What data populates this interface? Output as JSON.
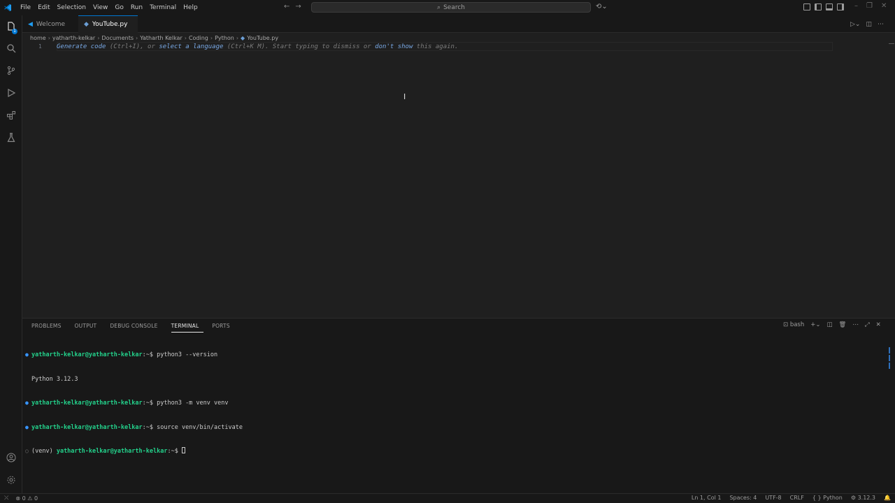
{
  "menu": [
    "File",
    "Edit",
    "Selection",
    "View",
    "Go",
    "Run",
    "Terminal",
    "Help"
  ],
  "search": {
    "placeholder": "Search"
  },
  "tabs": [
    {
      "label": "Welcome"
    },
    {
      "label": "YouTube.py"
    }
  ],
  "breadcrumb": [
    "home",
    "yatharth-kelkar",
    "Documents",
    "Yatharth Kelkar",
    "Coding",
    "Python",
    "YouTube.py"
  ],
  "editor": {
    "line_number": "1",
    "hint": {
      "generate": "Generate code",
      "shortcut1": " (Ctrl+I), or ",
      "select_lang": "select a language",
      "shortcut2": " (Ctrl+K M). Start typing to dismiss or ",
      "dont_show": "don't show",
      "tail": " this again."
    }
  },
  "activity_badge": "1",
  "panel": {
    "tabs": [
      "PROBLEMS",
      "OUTPUT",
      "DEBUG CONSOLE",
      "TERMINAL",
      "PORTS"
    ],
    "terminal_name": "bash",
    "lines": [
      {
        "prompt": "yatharth-kelkar@yatharth-kelkar",
        "suffix": ":~$ ",
        "cmd": "python3 --version",
        "dot": true
      },
      {
        "prompt": "",
        "suffix": "",
        "cmd": "Python 3.12.3",
        "dot": false
      },
      {
        "prompt": "yatharth-kelkar@yatharth-kelkar",
        "suffix": ":~$ ",
        "cmd": "python3 -m venv venv",
        "dot": true
      },
      {
        "prompt": "yatharth-kelkar@yatharth-kelkar",
        "suffix": ":~$ ",
        "cmd": "source venv/bin/activate",
        "dot": true
      },
      {
        "pre": "(venv) ",
        "prompt": "yatharth-kelkar@yatharth-kelkar",
        "suffix": ":~$ ",
        "cmd": "",
        "dot": false
      }
    ]
  },
  "status": {
    "errors": "0",
    "warnings": "0",
    "position": "Ln 1, Col 1",
    "spaces": "Spaces: 4",
    "encoding": "UTF-8",
    "eol": "CRLF",
    "language": "Python",
    "interpreter": "3.12.3"
  },
  "colors": {
    "accent": "#0078d4",
    "prompt_green": "#23d18b",
    "link_blue": "#79a9e6"
  }
}
